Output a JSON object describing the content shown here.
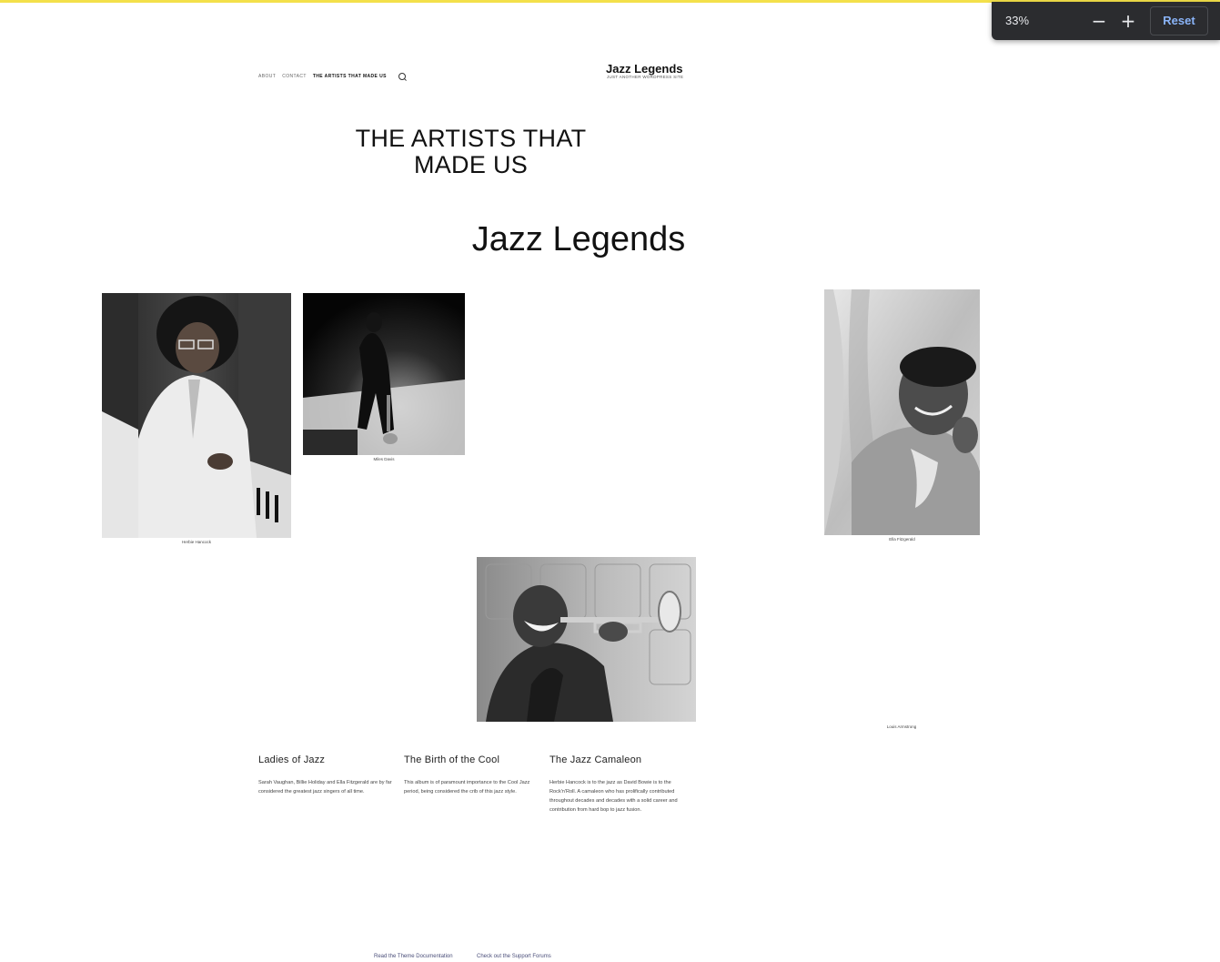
{
  "zoom": {
    "percent": "33%",
    "minus_label": "−",
    "plus_label": "+",
    "reset_label": "Reset"
  },
  "nav": {
    "items": [
      "ABOUT",
      "CONTACT",
      "THE ARTISTS THAT MADE US"
    ]
  },
  "site": {
    "title": "Jazz Legends",
    "tagline": "JUST ANOTHER WORDPRESS SITE"
  },
  "page": {
    "title_line1": "THE ARTISTS THAT",
    "title_line2": "MADE US",
    "section_title": "Jazz Legends"
  },
  "gallery": {
    "captions": [
      "Herbie Hancock",
      "Miles Davis",
      "Ella Fitzgerald",
      "Louis Armstrong"
    ]
  },
  "columns": [
    {
      "title": "Ladies of Jazz",
      "text": "Sarah Vaughan, Billie Holiday and Ella Fitzgerald are by far considered the greatest jazz singers of all time."
    },
    {
      "title": "The Birth of the Cool",
      "text": "This album is of paramount importance to the Cool Jazz period, being considered the crib of this jazz style."
    },
    {
      "title": "The Jazz Camaleon",
      "text": "Herbie Hancock is to the jazz as David Bowie is to the Rock'n'Roll. A camaleon who has prolifically contributed throughout decades and decades with a solid career and contribution from hard bop to jazz fusion."
    }
  ],
  "footer": {
    "links": [
      "Read the Theme Documentation",
      "Check out the Support Forums"
    ]
  },
  "colors": {
    "accent_bar": "#f3e04a",
    "reset_blue": "#8ab4f8",
    "popup_bg": "#2b2c2f"
  }
}
